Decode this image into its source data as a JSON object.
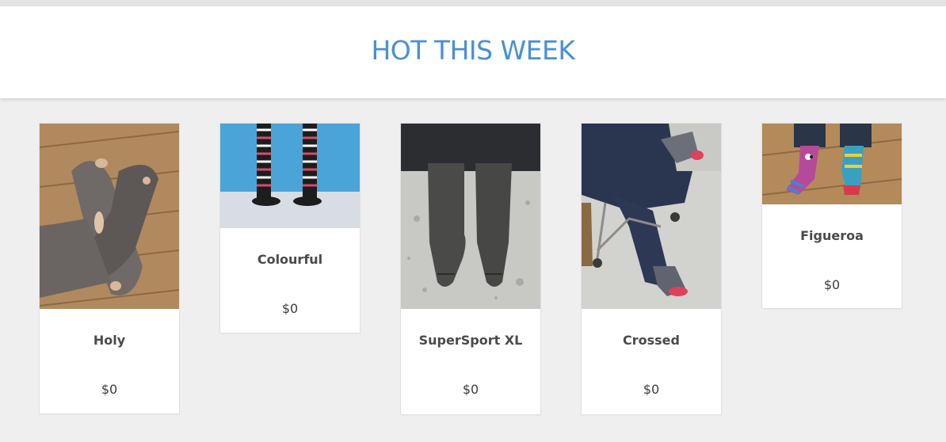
{
  "header": {
    "title": "HOT THIS WEEK"
  },
  "products": [
    {
      "name": "Holy",
      "price": "$0",
      "image": "worn-grey-socks-with-holes"
    },
    {
      "name": "Colourful",
      "price": "$0",
      "image": "striped-knee-socks"
    },
    {
      "name": "SuperSport XL",
      "price": "$0",
      "image": "grey-sport-socks"
    },
    {
      "name": "Crossed",
      "price": "$0",
      "image": "crossed-legs-patterned-socks"
    },
    {
      "name": "Figueroa",
      "price": "$0",
      "image": "mismatched-colourful-socks"
    }
  ],
  "colors": {
    "accent": "#4a8fd8",
    "background": "#efefef",
    "card": "#ffffff",
    "text": "#4a4a4a"
  }
}
